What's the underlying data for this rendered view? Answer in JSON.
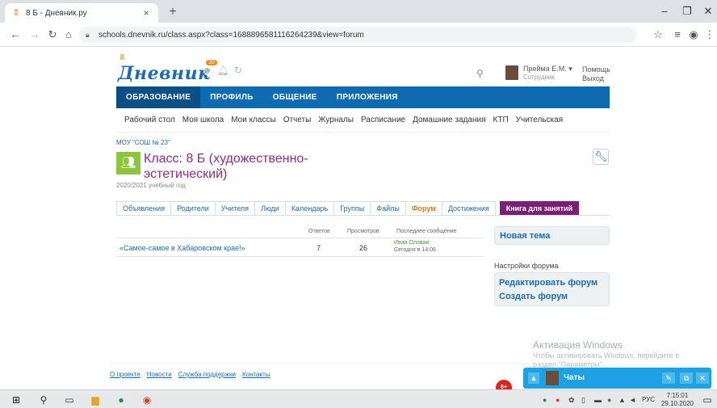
{
  "browser": {
    "tab_title": "8 Б - Дневник.ру",
    "tab_close": "×",
    "new_tab": "+",
    "url": "schools.dnevnik.ru/class.aspx?class=1688896581116264239&view=forum",
    "minimize": "–",
    "maximize": "❐",
    "close": "✕"
  },
  "header": {
    "logo_text": "Дневник",
    "notifications_count": "10",
    "user_name": "Прейма Е.М. ▾",
    "user_role": "Сотрудник",
    "help_link": "Помощь",
    "logout_link": "Выход"
  },
  "main_nav": [
    {
      "label": "ОБРАЗОВАНИЕ",
      "active": true
    },
    {
      "label": "ПРОФИЛЬ",
      "active": false
    },
    {
      "label": "ОБЩЕНИЕ",
      "active": false
    },
    {
      "label": "ПРИЛОЖЕНИЯ",
      "active": false
    }
  ],
  "sub_nav": [
    "Рабочий стол",
    "Моя школа",
    "Мои классы",
    "Отчеты",
    "Журналы",
    "Расписание",
    "Домашние задания",
    "КТП",
    "Учительская"
  ],
  "page": {
    "breadcrumb": "МОУ \"СОШ № 23\"",
    "class_title": "Класс: 8 Б (художественно-эстетический)",
    "school_year": "2020/2021 учебный год"
  },
  "tabs": [
    {
      "label": "Объявления",
      "active": false
    },
    {
      "label": "Родители",
      "active": false
    },
    {
      "label": "Учителя",
      "active": false
    },
    {
      "label": "Люди",
      "active": false
    },
    {
      "label": "Календарь",
      "active": false
    },
    {
      "label": "Группы",
      "active": false
    },
    {
      "label": "Файлы",
      "active": false
    },
    {
      "label": "Форум",
      "active": true
    },
    {
      "label": "Достижения",
      "active": false
    },
    {
      "label": "Книга для занятий",
      "active": false,
      "special": true
    }
  ],
  "forum": {
    "col_replies": "Ответов",
    "col_views": "Просмотров",
    "col_last": "Последнее сообщение",
    "threads": [
      {
        "title": "«Самое-самое в Хабаровском крае!»",
        "replies": "7",
        "views": "26",
        "author": "Иван Оловаи",
        "date": "Сегодня в 14:06"
      }
    ]
  },
  "sidebar": {
    "new_topic": "Новая тема",
    "settings_label": "Настройки форума",
    "edit_forum": "Редактировать форум",
    "create_forum": "Создать форум"
  },
  "activation": {
    "title": "Активация Windows",
    "line1": "Чтобы активировать Windows, перейдите в",
    "line2": "раздел \"Параметры\"."
  },
  "footer_links": [
    "О проекте",
    "Новости",
    "Служба поддержки",
    "Контакты"
  ],
  "chat": {
    "title": "Чаты",
    "badge": "6+"
  },
  "taskbar": {
    "lang": "РУС",
    "time": "7:15:01",
    "date": "29.10.2020"
  },
  "colors": {
    "accent": "#0f6bb0",
    "class_title": "#8e2d85",
    "active_tab": "#e07a1f",
    "special_tab": "#7a1f73",
    "chat": "#1da1e2"
  }
}
